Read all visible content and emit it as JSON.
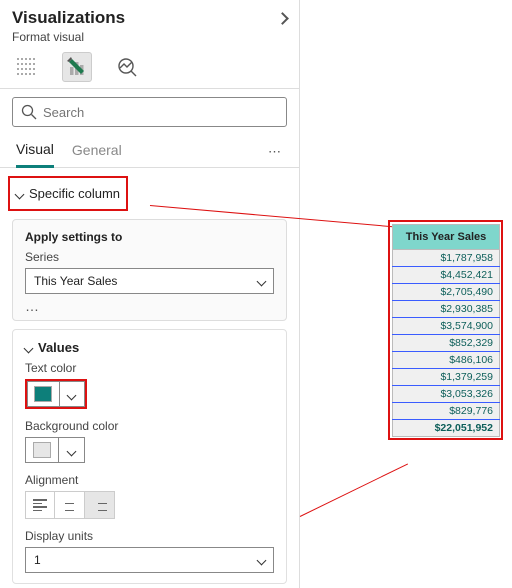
{
  "pane": {
    "title": "Visualizations",
    "subtitle": "Format visual"
  },
  "search": {
    "placeholder": "Search"
  },
  "tabs": {
    "visual": "Visual",
    "general": "General"
  },
  "section": {
    "specific_column": "Specific column"
  },
  "apply": {
    "heading": "Apply settings to",
    "series_label": "Series",
    "series_value": "This Year Sales"
  },
  "values": {
    "heading": "Values",
    "text_color_label": "Text color",
    "text_color": "#0d7f7a",
    "bg_color_label": "Background color",
    "bg_color": "#e6e6e6",
    "alignment_label": "Alignment",
    "display_units_label": "Display units",
    "display_units_value": "1"
  },
  "preview": {
    "header": "This Year Sales",
    "rows": [
      "$1,787,958",
      "$4,452,421",
      "$2,705,490",
      "$2,930,385",
      "$3,574,900",
      "$852,329",
      "$486,106",
      "$1,379,259",
      "$3,053,326",
      "$829,776"
    ],
    "total": "$22,051,952"
  }
}
